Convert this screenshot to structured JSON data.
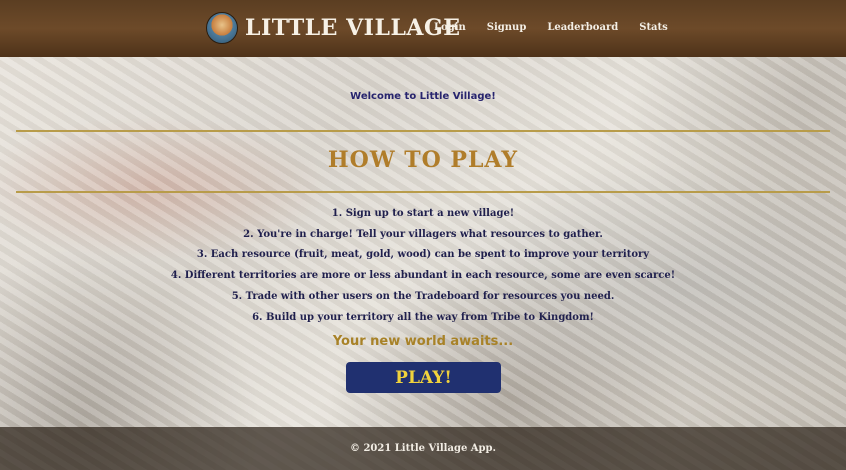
{
  "header": {
    "brand": "LITTLE VILLAGE",
    "logo_icon": "village-emblem-icon",
    "nav": [
      "Login",
      "Signup",
      "Leaderboard",
      "Stats"
    ]
  },
  "main": {
    "welcome": "Welcome to Little Village!",
    "heading": "HOW TO PLAY",
    "steps": [
      "1. Sign up to start a new village!",
      "2. You're in charge! Tell your villagers what resources to gather.",
      "3. Each resource (fruit, meat, gold, wood) can be spent to improve your territory",
      "4. Different territories are more or less abundant in each resource, some are even scarce!",
      "5. Trade with other users on the Tradeboard for resources you need.",
      "6. Build up your territory all the way from Tribe to Kingdom!"
    ],
    "tagline": "Your new world awaits...",
    "play_label": "PLAY!"
  },
  "footer": {
    "copyright": "© 2021 Little Village App."
  },
  "colors": {
    "header_bg": "#5b3e22",
    "heading": "#b07d2a",
    "rule": "#b89c4a",
    "play_bg": "#203070",
    "play_text": "#f0d23c",
    "step_text": "#1f1f4d"
  }
}
